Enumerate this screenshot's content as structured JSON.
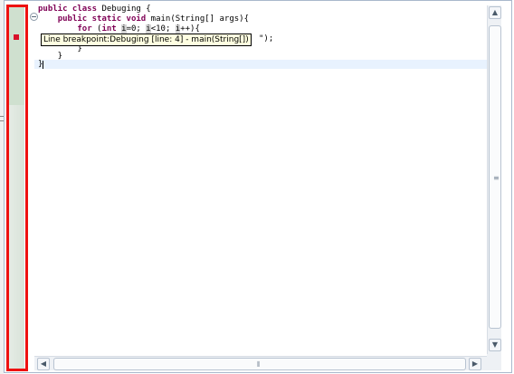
{
  "editor": {
    "code": {
      "line1": {
        "kw": "public class",
        "rest": " Debuging {"
      },
      "line2": {
        "indent": "    ",
        "kw": "public static void",
        "rest": " main(String[] args){"
      },
      "line3": {
        "indent": "        ",
        "kw": "for",
        "p1": " (",
        "kw2": "int",
        "sp": " ",
        "v1": "i",
        "p2": "=0; ",
        "v2": "i",
        "p3": "<10; ",
        "v3": "i",
        "p4": "++){"
      },
      "line4_tail": "\");",
      "line5": "        }",
      "line6": "    }",
      "line7": "}"
    },
    "tooltip": "Line breakpoint:Debuging [line: 4] - main(String[])",
    "current_line": 7,
    "breakpoint_line": 4
  },
  "icons": {
    "breakpoint": "breakpoint-marker-icon",
    "fold": "fold-collapse-icon",
    "scroll_up": "arrow-up-icon",
    "scroll_down": "arrow-down-icon",
    "scroll_left": "arrow-left-icon",
    "scroll_right": "arrow-right-icon",
    "grip": "scrollbar-grip-icon"
  },
  "colors": {
    "keyword": "#7f0055",
    "breakpoint": "#d8102a",
    "annotation_box": "#ee1111",
    "tooltip_bg": "#ffffe1",
    "current_line_bg": "#e8f2fe"
  }
}
